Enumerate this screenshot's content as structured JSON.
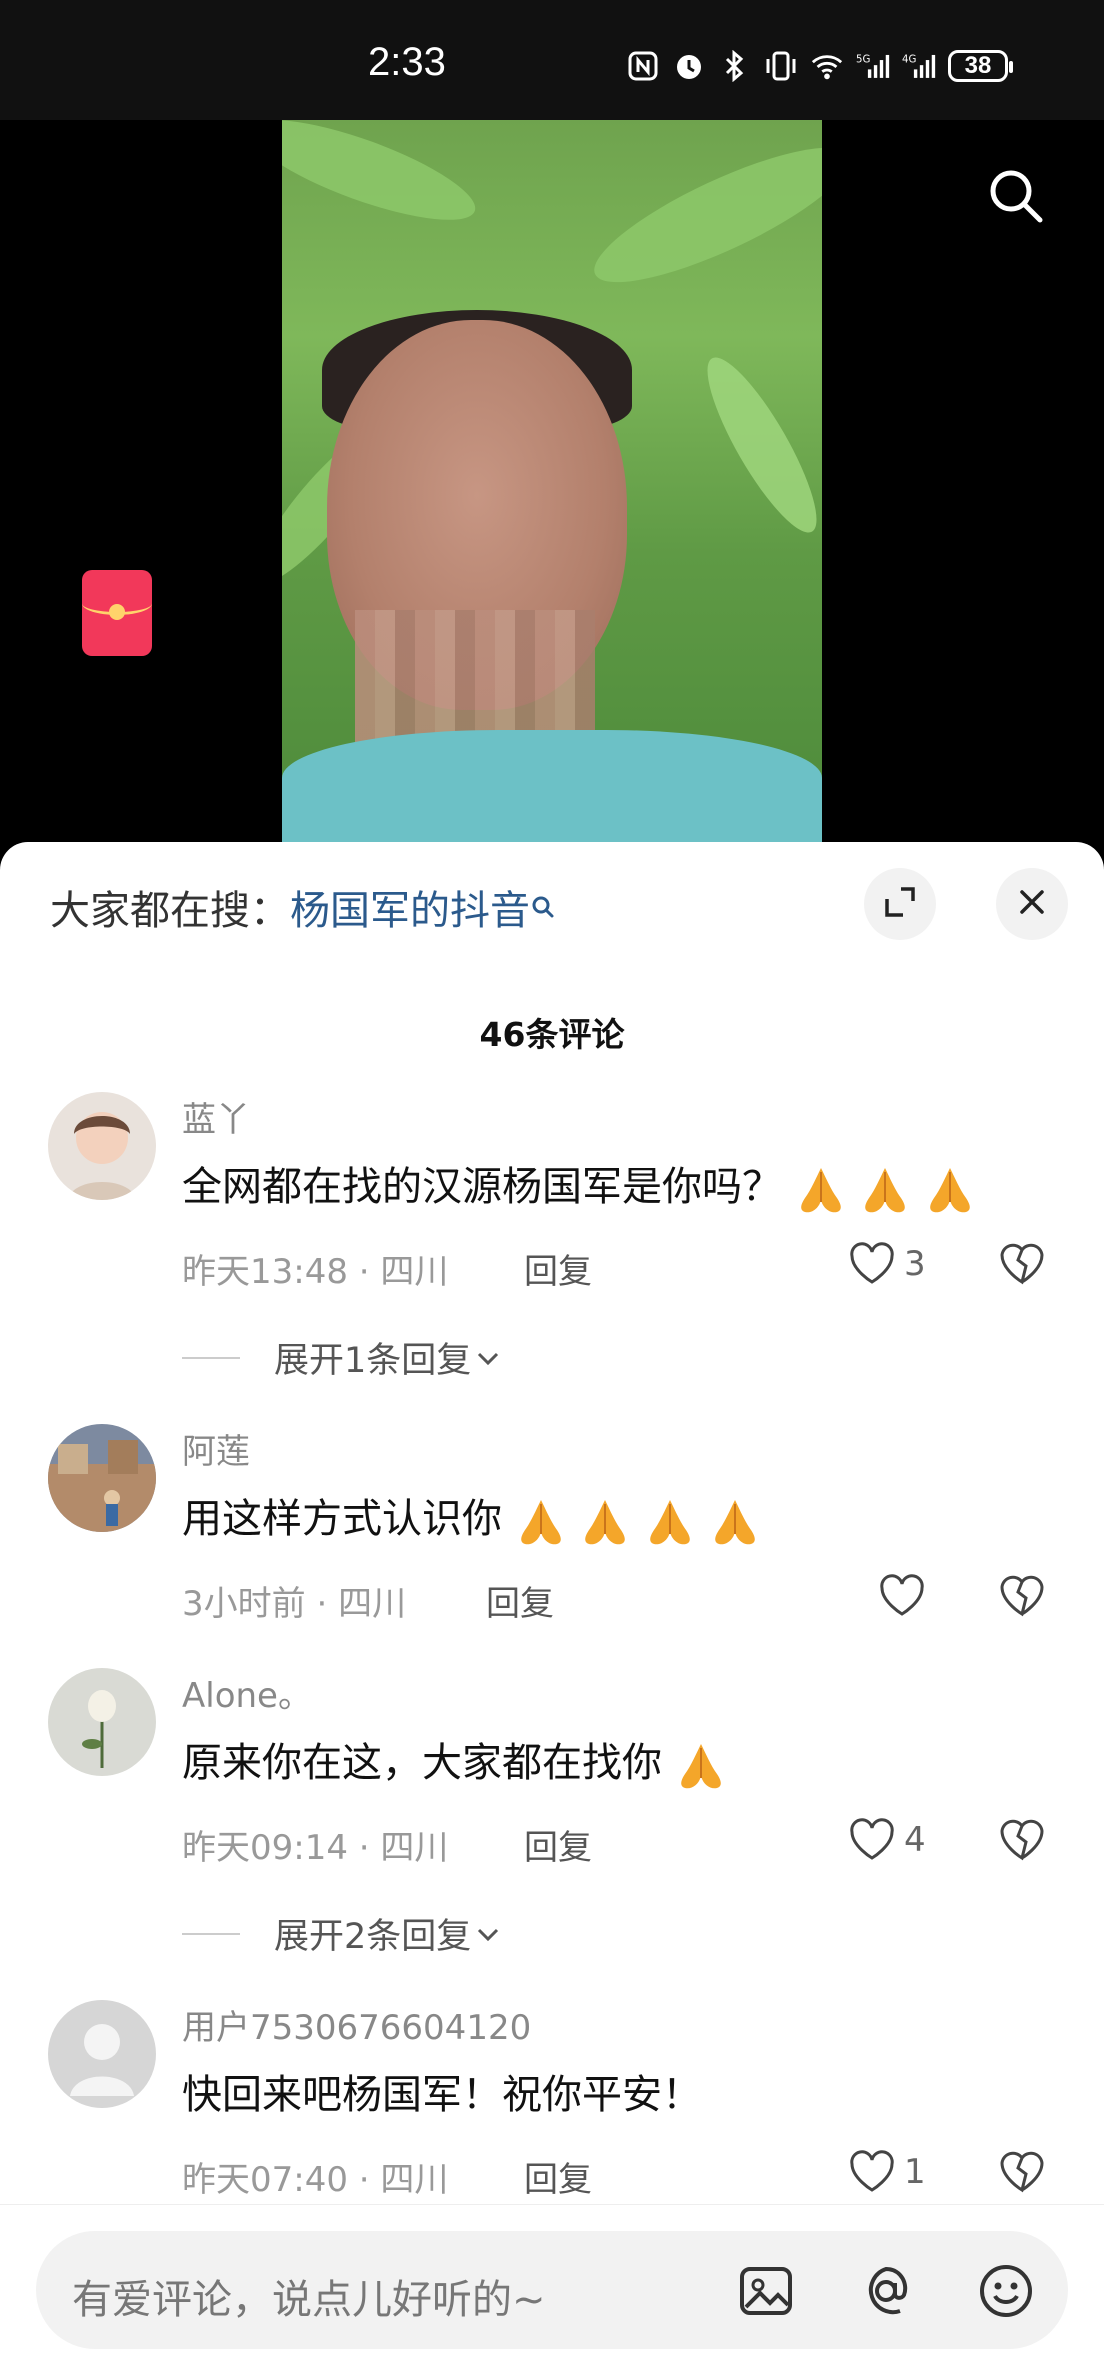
{
  "status_bar": {
    "time": "2:33",
    "battery": "38",
    "icons": [
      "nfc-icon",
      "alarm-icon",
      "bluetooth-icon",
      "vibrate-icon",
      "wifi-icon",
      "signal-5g-icon",
      "signal-4g-icon"
    ]
  },
  "video": {
    "search_icon": "search-icon",
    "red_packet_icon": "red-packet-icon"
  },
  "sheet": {
    "search_hint_label": "大家都在搜：",
    "search_hint_keyword": "杨国军的抖音",
    "comment_count": "46条评论",
    "comments": [
      {
        "username": "蓝丫",
        "text": "全网都在找的汉源杨国军是你吗？",
        "emoji_count": 3,
        "time": "昨天13:48",
        "location": "四川",
        "reply_label": "回复",
        "likes": "3",
        "expand_label": "展开1条回复"
      },
      {
        "username": "阿莲",
        "text": "用这样方式认识你",
        "emoji_count": 4,
        "time": "3小时前",
        "location": "四川",
        "reply_label": "回复",
        "likes": ""
      },
      {
        "username": "Alone。",
        "text": "原来你在这，大家都在找你",
        "emoji_count": 1,
        "time": "昨天09:14",
        "location": "四川",
        "reply_label": "回复",
        "likes": "4",
        "expand_label": "展开2条回复"
      },
      {
        "username": "用户7530676604120",
        "text": "快回来吧杨国军！祝你平安！",
        "emoji_count": 0,
        "time": "昨天07:40",
        "location": "四川",
        "reply_label": "回复",
        "likes": "1"
      }
    ]
  },
  "input_bar": {
    "placeholder": "有爱评论，说点儿好听的~",
    "icons": [
      "image-icon",
      "at-icon",
      "emoji-icon"
    ]
  }
}
